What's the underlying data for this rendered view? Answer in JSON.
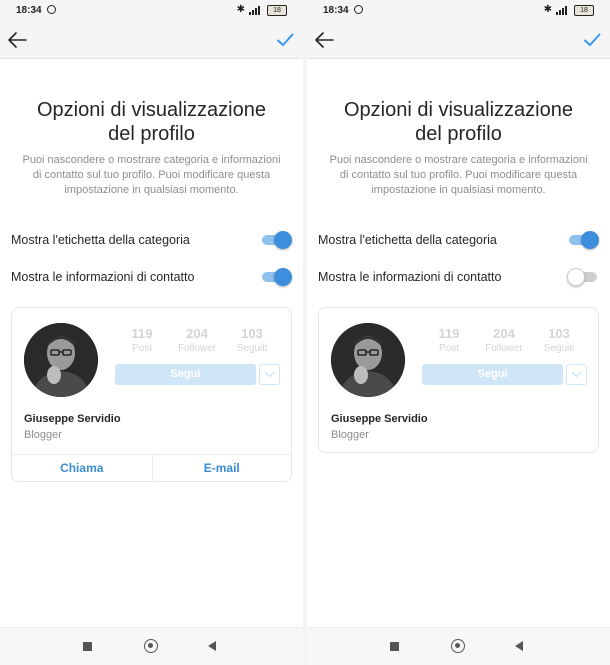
{
  "status_bar": {
    "time": "18:34",
    "battery": "18",
    "icons": [
      "alarm-icon",
      "bluetooth-icon",
      "signal-icon",
      "battery-icon"
    ]
  },
  "app_bar": {
    "icons": [
      "back-arrow-icon",
      "checkmark-icon"
    ],
    "accent_color": "#3897f0"
  },
  "left_screen": {
    "title": "Opzioni di visualizzazione\ndel profilo",
    "description": "Puoi nascondere o mostrare categoria e informazioni\ndi contatto sul tuo profilo. Puoi modificare questa\nimpostazione in qualsiasi momento.",
    "toggles": [
      {
        "label": "Mostra l'etichetta della categoria",
        "state": "on"
      },
      {
        "label": "Mostra le informazioni di contatto",
        "state": "on"
      }
    ],
    "profile_preview": {
      "stats": [
        {
          "value": "119",
          "label": "Post"
        },
        {
          "value": "204",
          "label": "Follower"
        },
        {
          "value": "103",
          "label": "Seguiti"
        }
      ],
      "follow_label": "Segui",
      "name": "Giuseppe Servidio",
      "category": "Blogger",
      "contact_buttons": [
        "Chiama",
        "E-mail"
      ]
    }
  },
  "right_screen": {
    "title": "Opzioni di visualizzazione\ndel profilo",
    "description": "Puoi nascondere o mostrare categoria e informazioni\ndi contatto sul tuo profilo. Puoi modificare questa\nimpostazione in qualsiasi momento.",
    "toggles": [
      {
        "label": "Mostra l'etichetta della categoria",
        "state": "on"
      },
      {
        "label": "Mostra le informazioni di contatto",
        "state": "off"
      }
    ],
    "profile_preview": {
      "stats": [
        {
          "value": "119",
          "label": "Post"
        },
        {
          "value": "204",
          "label": "Follower"
        },
        {
          "value": "103",
          "label": "Seguiti"
        }
      ],
      "follow_label": "Segui",
      "name": "Giuseppe Servidio",
      "category": "Blogger"
    }
  },
  "nav_bar": {
    "icons": [
      "recent-apps-icon",
      "home-icon",
      "back-icon"
    ]
  },
  "colors": {
    "toggle_on": "#3d8fdd",
    "toggle_track_on": "#8ec1ee",
    "link": "#3b8ed3",
    "follow_disabled": "#cfe5f8"
  }
}
